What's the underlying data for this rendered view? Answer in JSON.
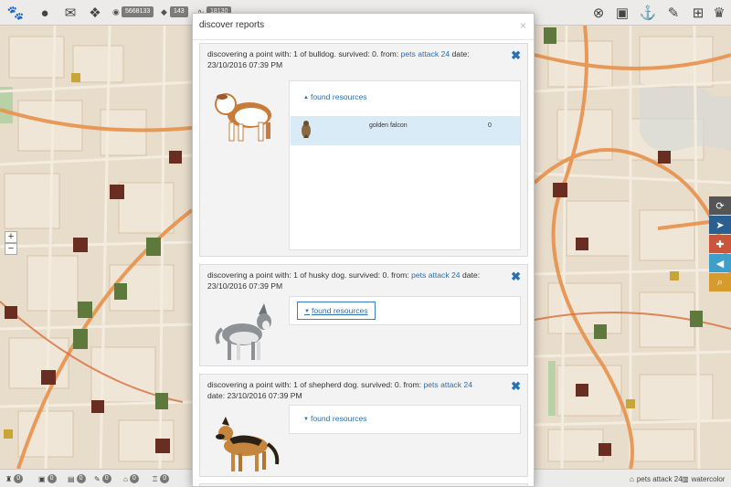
{
  "topbar": {
    "paw_icon": "paw-icon",
    "stats": [
      {
        "icon": "coins-icon",
        "value": "5668133"
      },
      {
        "icon": "diamond-icon",
        "value": "143"
      },
      {
        "icon": "pulse-icon",
        "value": "18130"
      }
    ]
  },
  "modal": {
    "title": "discover reports",
    "close": "×",
    "reports": [
      {
        "text_prefix": "discovering a point with: 1 of bulldog. survived: 0. from: ",
        "link": "pets attack 24",
        "text_suffix": " date: 23/10/2016 07:39 PM",
        "tab_label": "found resources",
        "resources": [
          {
            "name": "golden falcon",
            "count": "0"
          }
        ]
      },
      {
        "text_prefix": "discovering a point with: 1 of husky dog. survived: 0. from: ",
        "link": "pets attack 24",
        "text_suffix": " date: 23/10/2016 07:39 PM",
        "tab_label": "found resources"
      },
      {
        "text_prefix": "discovering a point with: 1 of shepherd dog. survived: 0. from: ",
        "link": "pets attack 24",
        "text_suffix": " date: 23/10/2016 07:39 PM",
        "tab_label": "found resources"
      }
    ]
  },
  "bottombar": {
    "counts": [
      "0",
      "0",
      "0",
      "0",
      "0",
      "0"
    ],
    "user": "pets attack 24",
    "map_style": "watercolor"
  },
  "colors": {
    "link": "#2a6fb0",
    "highlight_row": "#d9ebf7",
    "tool_refresh": "#555555",
    "tool_locate": "#2b5f8f",
    "tool_add": "#c9553c",
    "tool_announce": "#3ea0c9",
    "tool_search": "#d69a2d"
  }
}
